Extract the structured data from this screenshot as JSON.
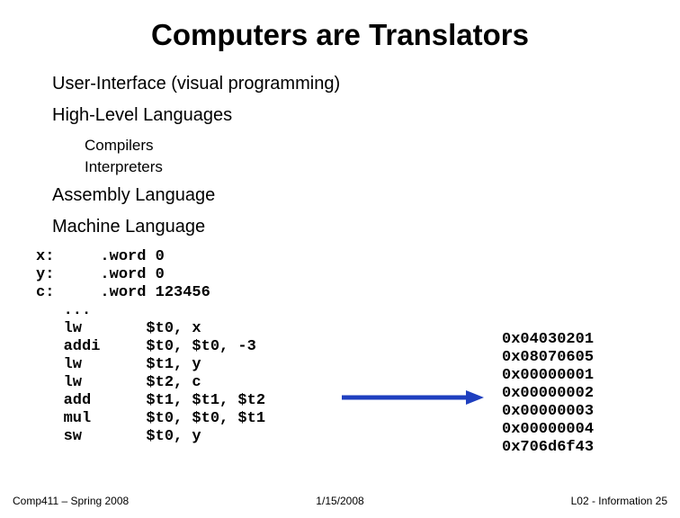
{
  "title": "Computers are Translators",
  "bullets": {
    "ui": "User-Interface (visual programming)",
    "hll": "High-Level Languages",
    "compilers": "Compilers",
    "interpreters": "Interpreters",
    "asm": "Assembly Language",
    "ml": "Machine Language"
  },
  "code": "x:     .word 0\ny:     .word 0\nc:     .word 123456\n   ...\n   lw       $t0, x\n   addi     $t0, $t0, -3\n   lw       $t1, y\n   lw       $t2, c\n   add      $t1, $t1, $t2\n   mul      $t0, $t0, $t1\n   sw       $t0, y",
  "hex": "0x04030201\n0x08070605\n0x00000001\n0x00000002\n0x00000003\n0x00000004\n0x706d6f43",
  "footer": {
    "left": "Comp411 – Spring 2008",
    "center": "1/15/2008",
    "right": "L02 - Information  25"
  }
}
